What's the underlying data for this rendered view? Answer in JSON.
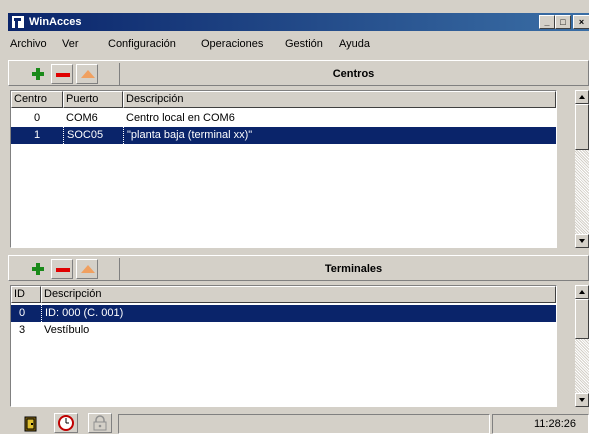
{
  "window": {
    "title": "WinAcces"
  },
  "menu": {
    "items": [
      "Archivo",
      "Ver",
      "Configuración",
      "Operaciones",
      "Gestión",
      "Ayuda"
    ]
  },
  "centros": {
    "title": "Centros",
    "columns": [
      "Centro",
      "Puerto",
      "Descripción"
    ],
    "rows": [
      {
        "centro": "0",
        "puerto": "COM6",
        "descripcion": "Centro local en COM6"
      },
      {
        "centro": "1",
        "puerto": "SOC05",
        "descripcion": "\"planta baja (terminal xx)\""
      }
    ],
    "selected_index": 1
  },
  "terminales": {
    "title": "Terminales",
    "columns": [
      "ID",
      "Descripción"
    ],
    "rows": [
      {
        "id": "0",
        "descripcion": "ID: 000 (C. 001)"
      },
      {
        "id": "3",
        "descripcion": "Vestíbulo"
      }
    ],
    "selected_index": 0
  },
  "toolbar_icons": [
    "add-icon",
    "remove-icon",
    "move-up-icon"
  ],
  "statusbar": {
    "time": "11:28:26",
    "icons": [
      "exit-door-icon",
      "clock-icon",
      "lock-icon"
    ]
  },
  "colors": {
    "title_bar": "#0a246a",
    "selection": "#0a246a",
    "add": "#1a8a1a",
    "remove": "#e00000",
    "up": "#f0a060"
  }
}
